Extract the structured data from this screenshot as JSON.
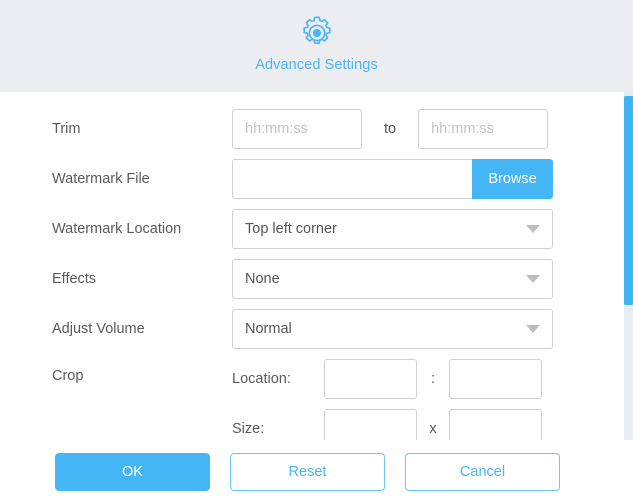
{
  "header": {
    "icon": "gear-icon",
    "title": "Advanced Settings"
  },
  "form": {
    "trim": {
      "label": "Trim",
      "start_value": "",
      "start_placeholder": "hh:mm:ss",
      "separator": "to",
      "end_value": "",
      "end_placeholder": "hh:mm:ss"
    },
    "watermark_file": {
      "label": "Watermark File",
      "value": "",
      "placeholder": "",
      "browse_label": "Browse"
    },
    "watermark_location": {
      "label": "Watermark Location",
      "value": "Top left corner",
      "arrow_icon": "chevron-down-icon"
    },
    "effects": {
      "label": "Effects",
      "value": "None",
      "arrow_icon": "chevron-down-icon"
    },
    "adjust_volume": {
      "label": "Adjust Volume",
      "value": "Normal",
      "arrow_icon": "chevron-down-icon"
    },
    "crop": {
      "label": "Crop",
      "location": {
        "label": "Location:",
        "x_value": "",
        "separator": ":",
        "y_value": ""
      },
      "size": {
        "label": "Size:",
        "width_value": "",
        "separator": "x",
        "height_value": ""
      }
    }
  },
  "footer": {
    "ok_label": "OK",
    "reset_label": "Reset",
    "cancel_label": "Cancel"
  },
  "colors": {
    "accent": "#45b6f5",
    "header_bg": "#ebedf1",
    "scrollbar_thumb": "#42b4f4",
    "scrollbar_track": "#e6edf2"
  }
}
